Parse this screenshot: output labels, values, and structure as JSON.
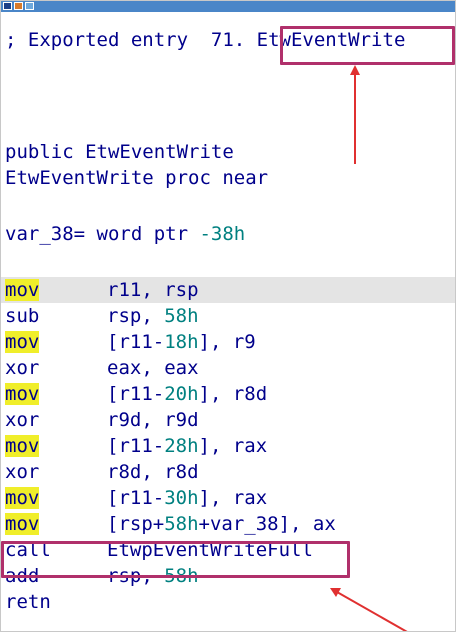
{
  "header_comment": {
    "prefix": "; Exported entry  71. ",
    "name": "EtwEventWrite"
  },
  "public_decl": {
    "keyword": "public ",
    "name": "EtwEventWrite"
  },
  "proc_decl": {
    "name": "EtwEventWrite",
    "rest": " proc near"
  },
  "var_decl": {
    "name": "var_38",
    "rest": "= word ptr ",
    "value": "-38h"
  },
  "instructions": [
    {
      "mnemonic": "mov",
      "highlight": true,
      "parts": [
        {
          "text": "r11, rsp"
        }
      ]
    },
    {
      "mnemonic": "sub",
      "highlight": false,
      "parts": [
        {
          "text": "rsp, "
        },
        {
          "text": "58h",
          "num": true
        }
      ]
    },
    {
      "mnemonic": "mov",
      "highlight": true,
      "parts": [
        {
          "text": "[r11-"
        },
        {
          "text": "18h",
          "num": true
        },
        {
          "text": "], r9"
        }
      ]
    },
    {
      "mnemonic": "xor",
      "highlight": false,
      "parts": [
        {
          "text": "eax, eax"
        }
      ]
    },
    {
      "mnemonic": "mov",
      "highlight": true,
      "parts": [
        {
          "text": "[r11-"
        },
        {
          "text": "20h",
          "num": true
        },
        {
          "text": "], r8d"
        }
      ]
    },
    {
      "mnemonic": "xor",
      "highlight": false,
      "parts": [
        {
          "text": "r9d, r9d"
        }
      ]
    },
    {
      "mnemonic": "mov",
      "highlight": true,
      "parts": [
        {
          "text": "[r11-"
        },
        {
          "text": "28h",
          "num": true
        },
        {
          "text": "], rax"
        }
      ]
    },
    {
      "mnemonic": "xor",
      "highlight": false,
      "parts": [
        {
          "text": "r8d, r8d"
        }
      ]
    },
    {
      "mnemonic": "mov",
      "highlight": true,
      "parts": [
        {
          "text": "[r11-"
        },
        {
          "text": "30h",
          "num": true
        },
        {
          "text": "], rax"
        }
      ]
    },
    {
      "mnemonic": "mov",
      "highlight": true,
      "parts": [
        {
          "text": "[rsp+"
        },
        {
          "text": "58h",
          "num": true
        },
        {
          "text": "+var_38], ax"
        }
      ]
    },
    {
      "mnemonic": "call",
      "highlight": false,
      "parts": [
        {
          "text": "EtwpEventWriteFull"
        }
      ]
    },
    {
      "mnemonic": "add",
      "highlight": false,
      "parts": [
        {
          "text": "rsp, "
        },
        {
          "text": "58h",
          "num": true
        }
      ]
    },
    {
      "mnemonic": "retn",
      "highlight": false,
      "parts": []
    }
  ],
  "colors": {
    "code_text": "#00008b",
    "number": "#008080",
    "mnemonic_highlight": "#f0ee2a",
    "selected_row": "#e4e4e4",
    "annotation": "#b0306b",
    "arrow": "#e03030"
  },
  "icons": [
    "ida-window-icon",
    "ida-edit-icon",
    "ida-graph-icon"
  ]
}
